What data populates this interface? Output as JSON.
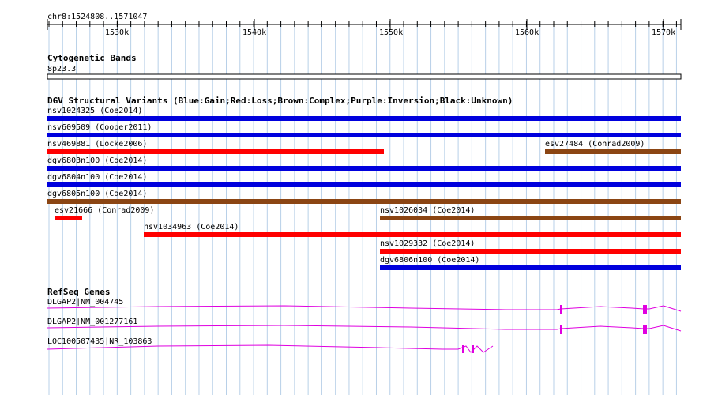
{
  "location": "chr8:1524808..1571047",
  "ruler": {
    "ticks": [
      "1530k",
      "1540k",
      "1550k",
      "1560k",
      "1570k"
    ]
  },
  "tracks": {
    "cytoband": {
      "title": "Cytogenetic Bands",
      "band": "8p23.3"
    },
    "dgv": {
      "title": "DGV Structural Variants (Blue:Gain;Red:Loss;Brown:Complex;Purple:Inversion;Black:Unknown)",
      "colors": {
        "gain": "#0000dd",
        "loss": "#ff0000",
        "complex": "#8b4513"
      },
      "variants": [
        {
          "label": "nsv1024325 (Coe2014)",
          "type": "gain"
        },
        {
          "label": "nsv609509 (Cooper2011)",
          "type": "gain"
        },
        {
          "label": "nsv469881 (Locke2006)",
          "type": "loss"
        },
        {
          "label": "esv27484 (Conrad2009)",
          "type": "complex"
        },
        {
          "label": "dgv6803n100 (Coe2014)",
          "type": "gain"
        },
        {
          "label": "dgv6804n100 (Coe2014)",
          "type": "gain"
        },
        {
          "label": "dgv6805n100 (Coe2014)",
          "type": "complex"
        },
        {
          "label": "esv21666 (Conrad2009)",
          "type": "loss"
        },
        {
          "label": "nsv1026034 (Coe2014)",
          "type": "complex"
        },
        {
          "label": "nsv1034963 (Coe2014)",
          "type": "loss"
        },
        {
          "label": "nsv1029332 (Coe2014)",
          "type": "loss"
        },
        {
          "label": "dgv6806n100 (Coe2014)",
          "type": "gain"
        }
      ]
    },
    "refseq": {
      "title": "RefSeq Genes",
      "color": "#e000e0",
      "genes": [
        {
          "label": "DLGAP2|NM_004745"
        },
        {
          "label": "DLGAP2|NM_001277161"
        },
        {
          "label": "LOC100507435|NR_103863"
        }
      ]
    }
  },
  "colors": {
    "grid": "#b8d0e8",
    "axis": "#000000"
  }
}
